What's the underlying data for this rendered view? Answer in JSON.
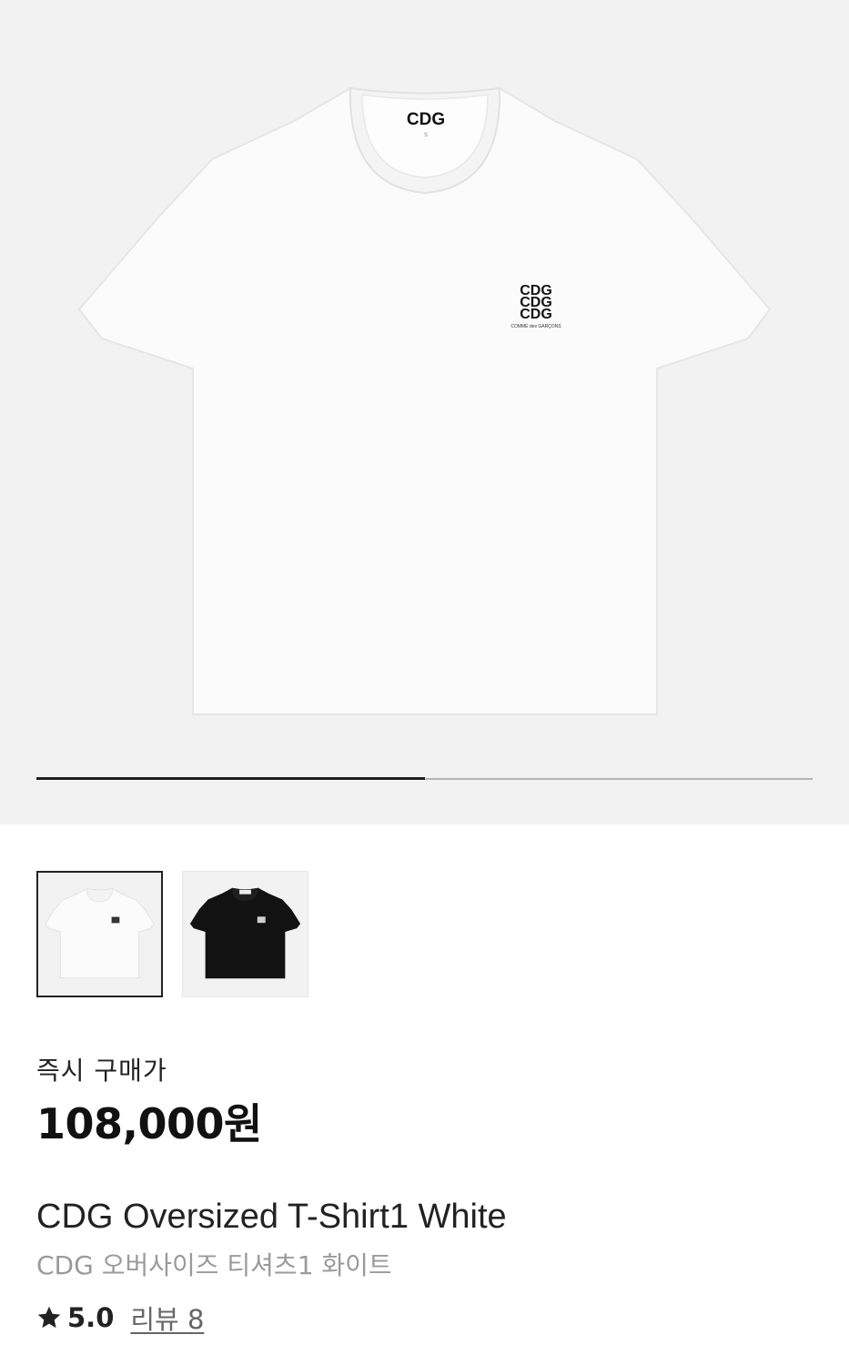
{
  "gallery": {
    "progress_fraction": 0.5,
    "hero_logo_text": "CDG",
    "print_lines": [
      "CDG",
      "CDG",
      "CDG"
    ],
    "print_caption": "COMME des GARÇONS",
    "thumbnails": [
      {
        "color": "white",
        "selected": true
      },
      {
        "color": "black",
        "selected": false
      }
    ]
  },
  "pricing": {
    "label": "즉시 구매가",
    "price": "108,000원"
  },
  "product": {
    "name_en": "CDG Oversized T-Shirt1 White",
    "name_ko": "CDG 오버사이즈 티셔츠1 화이트"
  },
  "rating": {
    "icon": "star-icon",
    "score": "5.0",
    "reviews": "리뷰 8"
  },
  "colors": {
    "hero_bg": "#f2f2f2",
    "progress_active": "#1e1e1e",
    "progress_track": "#b5b5b5",
    "subtitle_gray": "#9a9a9a"
  }
}
